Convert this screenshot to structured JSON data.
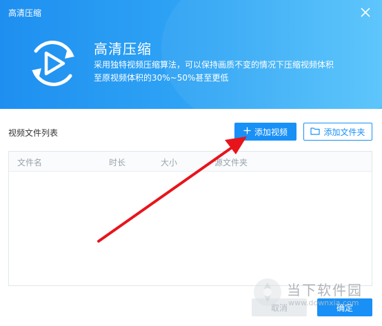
{
  "window": {
    "title": "高清压缩"
  },
  "header": {
    "title": "高清压缩",
    "description_line1": "采用独特视频压缩算法，可以保持画质不变的情况下压缩视频体积",
    "description_line2": "至原视频体积的30%~50%甚至更低",
    "logo_icon": "refresh-play-icon"
  },
  "toolbar": {
    "list_label": "视频文件列表",
    "add_video_label": "添加视频",
    "add_folder_label": "添加文件夹"
  },
  "table": {
    "columns": [
      "文件名",
      "时长",
      "大小",
      "源文件夹"
    ],
    "rows": []
  },
  "footer": {
    "cancel_label": "取消",
    "ok_label": "确定"
  },
  "watermark": {
    "text": "当下软件园",
    "url": "www.downxia.com"
  },
  "colors": {
    "accent": "#1890f6",
    "header_gradient_start": "#1e8ff0",
    "header_gradient_end": "#54c3fb",
    "annotation_arrow": "#e8141b"
  }
}
